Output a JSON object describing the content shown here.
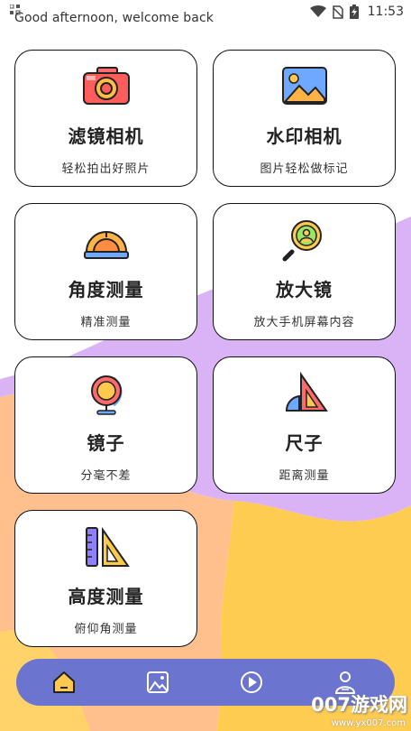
{
  "status_bar": {
    "greeting": "Good afternoon, welcome back",
    "time": "11:53"
  },
  "cards": [
    {
      "title": "滤镜相机",
      "subtitle": "轻松拍出好照片",
      "icon": "camera-icon"
    },
    {
      "title": "水印相机",
      "subtitle": "图片轻松做标记",
      "icon": "picture-icon"
    },
    {
      "title": "角度测量",
      "subtitle": "精准测量",
      "icon": "protractor-icon"
    },
    {
      "title": "放大镜",
      "subtitle": "放大手机屏幕内容",
      "icon": "magnifier-icon"
    },
    {
      "title": "镜子",
      "subtitle": "分毫不差",
      "icon": "mirror-icon"
    },
    {
      "title": "尺子",
      "subtitle": "距离测量",
      "icon": "triangle-ruler-icon"
    },
    {
      "title": "高度测量",
      "subtitle": "俯仰角测量",
      "icon": "height-ruler-icon"
    }
  ],
  "bottom_nav": [
    {
      "icon": "home-icon",
      "active": true
    },
    {
      "icon": "gallery-icon",
      "active": false
    },
    {
      "icon": "play-icon",
      "active": false
    },
    {
      "icon": "profile-icon",
      "active": false
    }
  ],
  "watermark": {
    "text": "007游戏网",
    "url": "www.yx007.com"
  },
  "colors": {
    "nav": "#6b74cf",
    "purple": "#d3a9f5",
    "orange": "#fdbd86",
    "yellow": "#ffc94d"
  }
}
